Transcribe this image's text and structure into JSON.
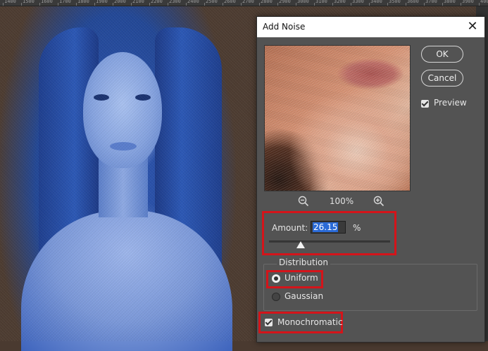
{
  "ruler": {
    "labels": [
      "1400",
      "1500",
      "1600",
      "1700",
      "1800",
      "1900",
      "2000",
      "2100",
      "2200",
      "2300",
      "2400",
      "2500",
      "2600",
      "2700",
      "2800",
      "2900",
      "3000",
      "3100",
      "3200",
      "3300",
      "3400",
      "3500",
      "3600",
      "3700",
      "3800",
      "3900",
      "4000"
    ]
  },
  "dialog": {
    "title": "Add Noise",
    "close_icon": "close-icon",
    "ok_label": "OK",
    "cancel_label": "Cancel",
    "preview_label": "Preview",
    "preview_checked": true,
    "zoom": {
      "value": "100%",
      "zoom_out_icon": "zoom-out-icon",
      "zoom_in_icon": "zoom-in-icon"
    },
    "amount": {
      "label": "Amount:",
      "value": "26.15",
      "unit": "%",
      "slider_fraction": 0.2615
    },
    "distribution": {
      "legend": "Distribution",
      "options": [
        {
          "label": "Uniform",
          "selected": true
        },
        {
          "label": "Gaussian",
          "selected": false
        }
      ]
    },
    "monochromatic": {
      "label": "Monochromatic",
      "checked": true
    }
  },
  "colors": {
    "highlight": "#d4141a",
    "dialog_bg": "#535353",
    "selection": "#2a6ad6"
  }
}
